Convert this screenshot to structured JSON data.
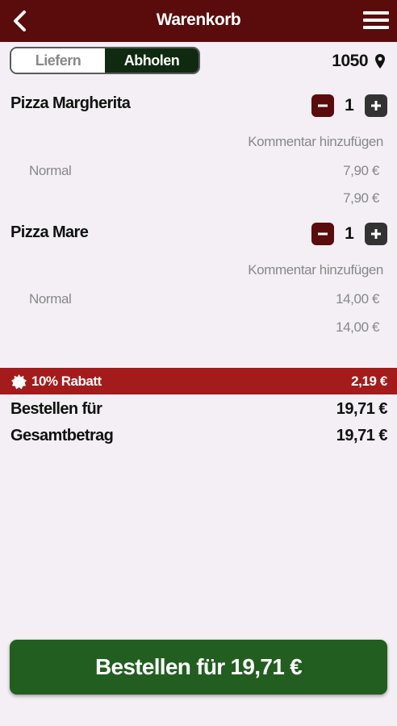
{
  "header": {
    "title": "Warenkorb"
  },
  "mode_toggle": {
    "options": [
      "Liefern",
      "Abholen"
    ],
    "selected": "Abholen"
  },
  "location": {
    "zip": "1050"
  },
  "items": [
    {
      "name": "Pizza Margherita",
      "quantity": "1",
      "comment_link": "Kommentar hinzufügen",
      "variant": "Normal",
      "variant_price": "7,90 €",
      "line_total": "7,90 €"
    },
    {
      "name": "Pizza Mare",
      "quantity": "1",
      "comment_link": "Kommentar hinzufügen",
      "variant": "Normal",
      "variant_price": "14,00 €",
      "line_total": "14,00 €"
    }
  ],
  "discount": {
    "label": "10% Rabatt",
    "amount": "2,19 €"
  },
  "summary": {
    "order_for_label": "Bestellen für",
    "order_for_value": "19,71 €",
    "total_label": "Gesamtbetrag",
    "total_value": "19,71 €"
  },
  "order_button": {
    "label": "Bestellen für 19,71 €"
  },
  "colors": {
    "header_bg": "#5a0b0b",
    "discount_bg": "#a31b1b",
    "order_button_bg": "#225e1f",
    "toggle_active_bg": "#0f2a10",
    "page_bg": "#f3eff5"
  }
}
